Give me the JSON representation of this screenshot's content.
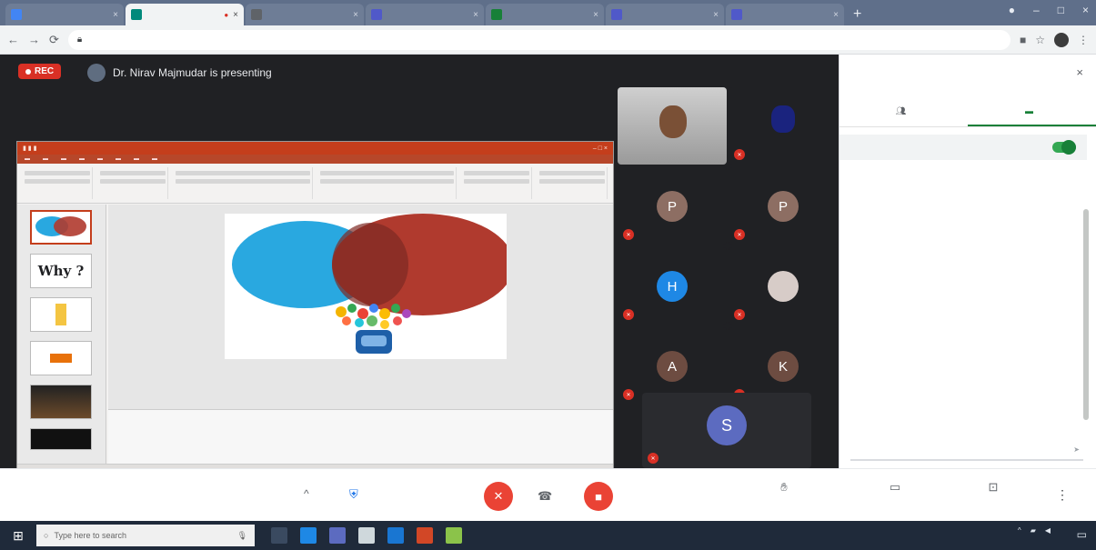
{
  "browser": {
    "tabs": [
      {
        "label": "",
        "color": "#4285f4"
      },
      {
        "label": "",
        "color": "#00897b"
      },
      {
        "label": "",
        "color": "#5f6368"
      },
      {
        "label": "",
        "color": "#5059c9"
      },
      {
        "label": "",
        "color": "#188038"
      },
      {
        "label": "",
        "color": "#5059c9"
      },
      {
        "label": "",
        "color": "#5059c9"
      }
    ],
    "new_tab": "+",
    "url": ""
  },
  "meet": {
    "rec_label": "REC",
    "presenter_text": "Dr. Nirav Majmudar is presenting",
    "participants": [
      {
        "name": "",
        "avatar": "",
        "color": "#5f6368",
        "photo": true
      },
      {
        "name": "",
        "avatar": "",
        "color": "#5f6368",
        "photo": false
      },
      {
        "name": "",
        "avatar": "P",
        "color": "#8d6e63"
      },
      {
        "name": "",
        "avatar": "P",
        "color": "#8d6e63"
      },
      {
        "name": "",
        "avatar": "H",
        "color": "#1e88e5"
      },
      {
        "name": "",
        "avatar": "",
        "color": "#d7ccc8"
      },
      {
        "name": "",
        "avatar": "A",
        "color": "#6d4c41"
      },
      {
        "name": "",
        "avatar": "K",
        "color": "#6d4c41"
      },
      {
        "name": "",
        "avatar": "S",
        "color": "#5c6bc0"
      }
    ]
  },
  "slides": {
    "thumb2_text": "Why ?"
  },
  "chat": {
    "title": "",
    "tab_people": "",
    "tab_chat": "",
    "toggle_label": "",
    "messages": []
  },
  "controls": {
    "meeting_title": "",
    "chevron": "^",
    "present_label": "",
    "captions_label": "",
    "presenting_label": "",
    "more": "⋮"
  },
  "taskbar": {
    "search_placeholder": "Type here to search",
    "time": "",
    "date": ""
  },
  "colors": {
    "accent_green": "#188038",
    "danger_red": "#ea4335",
    "ppt_orange": "#c43e1c",
    "venn_blue": "#29a8e0",
    "venn_red": "#b03a2e"
  }
}
